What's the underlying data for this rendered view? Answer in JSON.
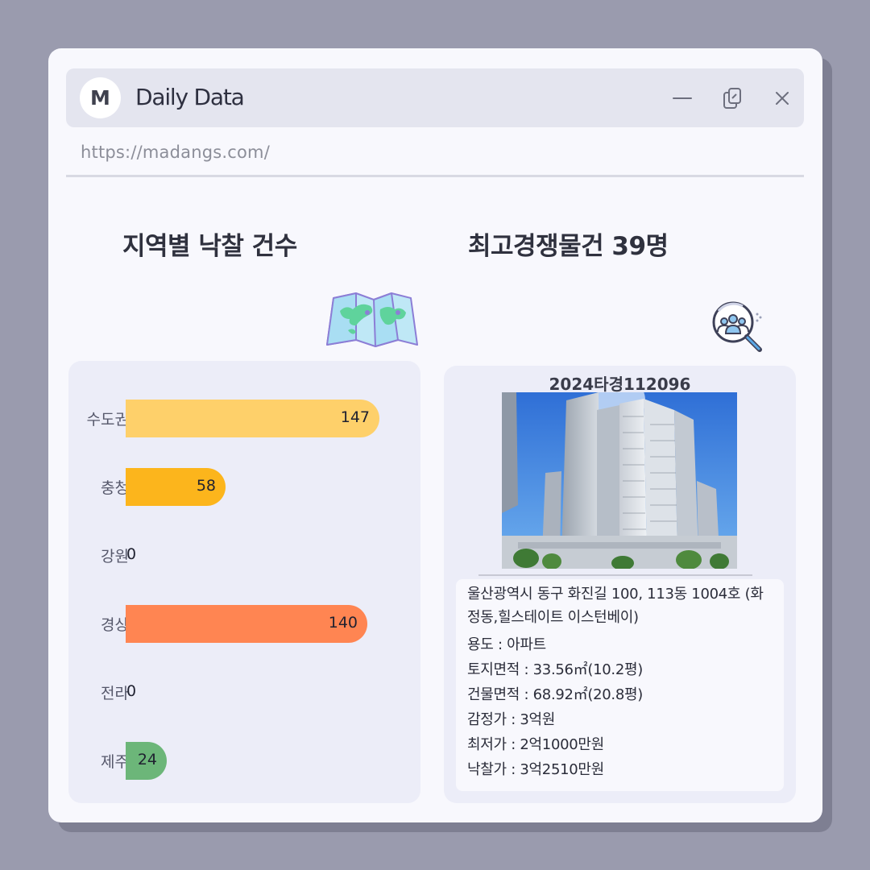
{
  "window": {
    "logo_letter": "M",
    "title": "Daily Data",
    "url": "https://madangs.com/"
  },
  "left_panel": {
    "title": "지역별 낙찰 건수",
    "icon": "folded-map-icon"
  },
  "right_panel": {
    "title": "최고경쟁물건 39명",
    "icon": "people-search-icon"
  },
  "chart_data": {
    "type": "bar",
    "orientation": "horizontal",
    "categories": [
      "수도권",
      "충청",
      "강원",
      "경상",
      "전라",
      "제주"
    ],
    "values": [
      147,
      58,
      0,
      140,
      0,
      24
    ],
    "colors": [
      "#fed06a",
      "#fcb51c",
      "#bbbbbb",
      "#ff8552",
      "#bbbbbb",
      "#6cb679"
    ],
    "xlim": [
      0,
      147
    ],
    "grid": false,
    "legend": "none"
  },
  "property": {
    "case_number": "2024타경112096",
    "address": "울산광역시 동구 화진길 100, 113동 1004호 (화정동,힐스테이트 이스턴베이)",
    "details": [
      "용도 : 아파트",
      "토지면적 : 33.56㎡(10.2평)",
      "건물면적 : 68.92㎡(20.8평)",
      "감정가 : 3억원",
      "최저가 : 2억1000만원",
      "낙찰가 : 3억2510만원"
    ]
  },
  "colors": {
    "background": "#9a9bae",
    "window": "#f8f8fd",
    "titlebar": "#e4e5ef",
    "card": "#ecedf8"
  }
}
